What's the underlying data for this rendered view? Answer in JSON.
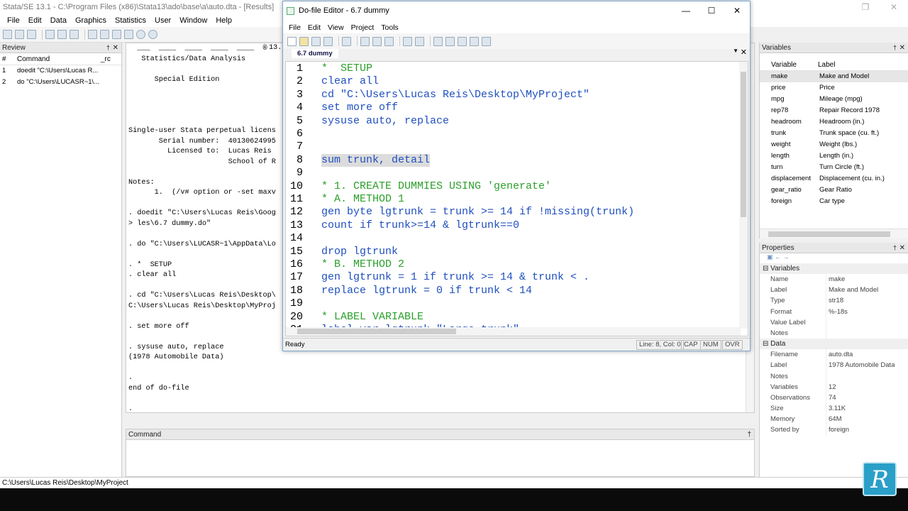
{
  "window": {
    "title": "Stata/SE 13.1 - C:\\Program Files (x86)\\Stata13\\ado\\base\\a\\auto.dta - [Results]"
  },
  "menu": [
    "File",
    "Edit",
    "Data",
    "Graphics",
    "Statistics",
    "User",
    "Window",
    "Help"
  ],
  "review": {
    "title": "Review",
    "col_num": "#",
    "col_command": "Command",
    "col_rc": "_rc",
    "rows": [
      {
        "n": "1",
        "cmd": "doedit \"C:\\Users\\Lucas R..."
      },
      {
        "n": "2",
        "cmd": "do \"C:\\Users\\LUCASR~1\\..."
      }
    ]
  },
  "results": {
    "lines": [
      "  ___  ____  ____  ____  ____  ®",
      "   Statistics/Data Analysis",
      "",
      "      Special Edition",
      "",
      "",
      "",
      "",
      "Single-user Stata perpetual licens",
      "       Serial number:  40130624995",
      "         Licensed to:  Lucas Reis",
      "                       School of R",
      "",
      "Notes:",
      "      1.  (/v# option or -set maxv",
      "",
      ". doedit \"C:\\Users\\Lucas Reis\\Goog",
      "> les\\6.7 dummy.do\"",
      "",
      ". do \"C:\\Users\\LUCASR~1\\AppData\\Lo",
      "",
      ". *  SETUP",
      ". clear all",
      "",
      ". cd \"C:\\Users\\Lucas Reis\\Desktop\\",
      "C:\\Users\\Lucas Reis\\Desktop\\MyProj",
      "",
      ". set more off",
      "",
      ". sysuse auto, replace",
      "(1978 Automobile Data)",
      "",
      ".",
      "end of do-file",
      "",
      "."
    ],
    "version_tag": "13."
  },
  "command": {
    "title": "Command"
  },
  "status_path": "C:\\Users\\Lucas Reis\\Desktop\\MyProject",
  "variables": {
    "title": "Variables",
    "col_variable": "Variable",
    "col_label": "Label",
    "rows": [
      {
        "name": "make",
        "label": "Make and Model"
      },
      {
        "name": "price",
        "label": "Price"
      },
      {
        "name": "mpg",
        "label": "Mileage (mpg)"
      },
      {
        "name": "rep78",
        "label": "Repair Record 1978"
      },
      {
        "name": "headroom",
        "label": "Headroom (in.)"
      },
      {
        "name": "trunk",
        "label": "Trunk space (cu. ft.)"
      },
      {
        "name": "weight",
        "label": "Weight (lbs.)"
      },
      {
        "name": "length",
        "label": "Length (in.)"
      },
      {
        "name": "turn",
        "label": "Turn Circle (ft.)"
      },
      {
        "name": "displacement",
        "label": "Displacement (cu. in.)"
      },
      {
        "name": "gear_ratio",
        "label": "Gear Ratio"
      },
      {
        "name": "foreign",
        "label": "Car type"
      }
    ]
  },
  "properties": {
    "title": "Properties",
    "variables_section": "Variables",
    "var_rows": [
      {
        "k": "Name",
        "v": "make"
      },
      {
        "k": "Label",
        "v": "Make and Model"
      },
      {
        "k": "Type",
        "v": "str18"
      },
      {
        "k": "Format",
        "v": "%-18s"
      },
      {
        "k": "Value Label",
        "v": ""
      },
      {
        "k": "Notes",
        "v": ""
      }
    ],
    "data_section": "Data",
    "data_rows": [
      {
        "k": "Filename",
        "v": "auto.dta"
      },
      {
        "k": "Label",
        "v": "1978 Automobile Data"
      },
      {
        "k": "Notes",
        "v": ""
      },
      {
        "k": "Variables",
        "v": "12"
      },
      {
        "k": "Observations",
        "v": "74"
      },
      {
        "k": "Size",
        "v": "3.11K"
      },
      {
        "k": "Memory",
        "v": "64M"
      },
      {
        "k": "Sorted by",
        "v": "foreign"
      }
    ]
  },
  "dofile": {
    "title": "Do-file Editor - 6.7 dummy",
    "menu": [
      "File",
      "Edit",
      "View",
      "Project",
      "Tools"
    ],
    "tab": "6.7 dummy",
    "status": "Ready",
    "position": "Line: 8, Col: 0",
    "cap": "CAP",
    "num": "NUM",
    "ovr": "OVR",
    "lines": [
      {
        "n": "1",
        "text": "*  SETUP",
        "cls": "cmt"
      },
      {
        "n": "2",
        "text": "clear all",
        "cls": "kw"
      },
      {
        "n": "3",
        "text": "cd \"C:\\Users\\Lucas Reis\\Desktop\\MyProject\"",
        "cls": "kw"
      },
      {
        "n": "4",
        "text": "set more off",
        "cls": "kw"
      },
      {
        "n": "5",
        "text": "sysuse auto, replace",
        "cls": "kw"
      },
      {
        "n": "6",
        "text": "",
        "cls": ""
      },
      {
        "n": "7",
        "text": "",
        "cls": ""
      },
      {
        "n": "8",
        "text": "sum trunk, detail",
        "cls": "kw hl"
      },
      {
        "n": "9",
        "text": "",
        "cls": ""
      },
      {
        "n": "10",
        "text": "* 1. CREATE DUMMIES USING 'generate'",
        "cls": "cmt"
      },
      {
        "n": "11",
        "text": "* A. METHOD 1",
        "cls": "cmt"
      },
      {
        "n": "12",
        "text": "gen byte lgtrunk = trunk >= 14 if !missing(trunk)",
        "cls": "kw"
      },
      {
        "n": "13",
        "text": "count if trunk>=14 & lgtrunk==0",
        "cls": "kw"
      },
      {
        "n": "14",
        "text": "",
        "cls": ""
      },
      {
        "n": "15",
        "text": "drop lgtrunk",
        "cls": "kw"
      },
      {
        "n": "16",
        "text": "* B. METHOD 2",
        "cls": "cmt"
      },
      {
        "n": "17",
        "text": "gen lgtrunk = 1 if trunk >= 14 & trunk < .",
        "cls": "kw"
      },
      {
        "n": "18",
        "text": "replace lgtrunk = 0 if trunk < 14",
        "cls": "kw"
      },
      {
        "n": "19",
        "text": "",
        "cls": ""
      },
      {
        "n": "20",
        "text": "* LABEL VARIABLE",
        "cls": "cmt"
      },
      {
        "n": "21",
        "text": "label var lgtrunk \"Large trunk\"",
        "cls": "kw"
      }
    ]
  },
  "logo_letter": "R"
}
